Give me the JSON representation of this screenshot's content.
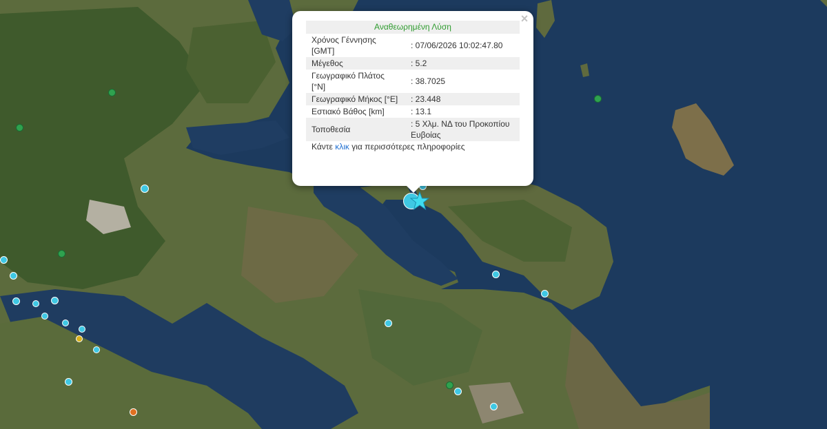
{
  "popup": {
    "title": "Αναθεωρημένη Λύση",
    "close_symbol": "×",
    "rows": [
      {
        "label": "Χρόνος Γέννησης [GMT]",
        "value": ": 07/06/2026 10:02:47.80"
      },
      {
        "label": "Μέγεθος",
        "value": ": 5.2"
      },
      {
        "label": "Γεωγραφικό Πλάτος [°N]",
        "value": ": 38.7025"
      },
      {
        "label": "Γεωγραφικό Μήκος [°E]",
        "value": ": 23.448"
      },
      {
        "label": "Εστιακό Βάθος [km]",
        "value": ": 13.1"
      },
      {
        "label": "Τοποθεσία",
        "value": ": 5 Χλμ. ΝΔ του Προκοπίου Ευβοίας"
      }
    ],
    "more_prefix": "Κάντε ",
    "more_link": "κλικ",
    "more_suffix": " για περισσότερες πληροφορίες"
  },
  "map": {
    "sea_color": "#1c3a5e",
    "land_color": "#5a6a3c",
    "epicenter_icon": "star-icon",
    "marker_colors": {
      "cyan": "#3fc8e4",
      "green": "#2fa24f",
      "orange": "#e07020",
      "yellow": "#d9b21c"
    }
  }
}
